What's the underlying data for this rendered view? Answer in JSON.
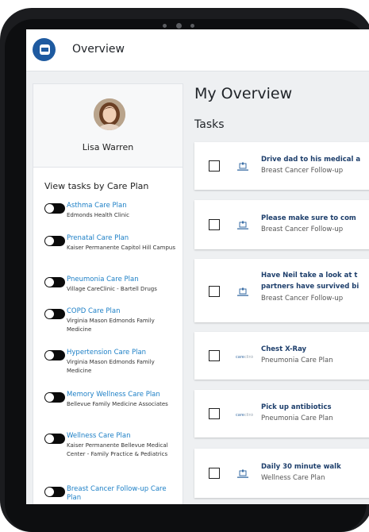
{
  "header": {
    "title": "Overview"
  },
  "profile": {
    "name": "Lisa Warren"
  },
  "sidebar": {
    "section_title": "View tasks by Care Plan",
    "plans": [
      {
        "name": "Asthma Care Plan",
        "clinic": "Edmonds Health Clinic",
        "enabled": true
      },
      {
        "name": "Prenatal Care Plan",
        "clinic": "Kaiser Permanente Capitol Hill Campus",
        "enabled": true
      },
      {
        "name": "Pneumonia Care Plan",
        "clinic": "Village CareClinic - Bartell Drugs",
        "enabled": true
      },
      {
        "name": "COPD Care Plan",
        "clinic": "Virginia Mason Edmonds Family Medicine",
        "enabled": true
      },
      {
        "name": "Hypertension Care Plan",
        "clinic": "Virginia Mason Edmonds Family Medicine",
        "enabled": true
      },
      {
        "name": "Memory Wellness Care Plan",
        "clinic": "Bellevue Family Medicine Associates",
        "enabled": true
      },
      {
        "name": "Wellness Care Plan",
        "clinic": "Kaiser Permanente Bellevue Medical Center - Family Practice & Pediatrics",
        "enabled": true
      },
      {
        "name": "Breast Cancer Follow-up Care Plan",
        "clinic": "",
        "enabled": true
      }
    ]
  },
  "main": {
    "title": "My Overview",
    "tasks_title": "Tasks",
    "tasks": [
      {
        "title": [
          "Drive dad to his medical a"
        ],
        "plan": "Breast Cancer Follow-up",
        "icon": "hospital-icon"
      },
      {
        "title": [
          "Please make sure to com"
        ],
        "plan": "Breast Cancer Follow-up",
        "icon": "hospital-icon"
      },
      {
        "title": [
          "Have Neil take a look at t",
          "partners have survived bi"
        ],
        "plan": "Breast Cancer Follow-up",
        "icon": "hospital-icon"
      },
      {
        "title": [
          "Chest X-Ray"
        ],
        "plan": "Pneumonia Care Plan",
        "icon": "careclinic-logo"
      },
      {
        "title": [
          "Pick up antibiotics"
        ],
        "plan": "Pneumonia Care Plan",
        "icon": "careclinic-logo"
      },
      {
        "title": [
          "Daily 30 minute walk"
        ],
        "plan": "Wellness Care Plan",
        "icon": "hospital-icon"
      }
    ]
  },
  "colors": {
    "accent": "#1c7fc6",
    "task_title": "#1e3f6c",
    "brand": "#1e5aa0"
  }
}
